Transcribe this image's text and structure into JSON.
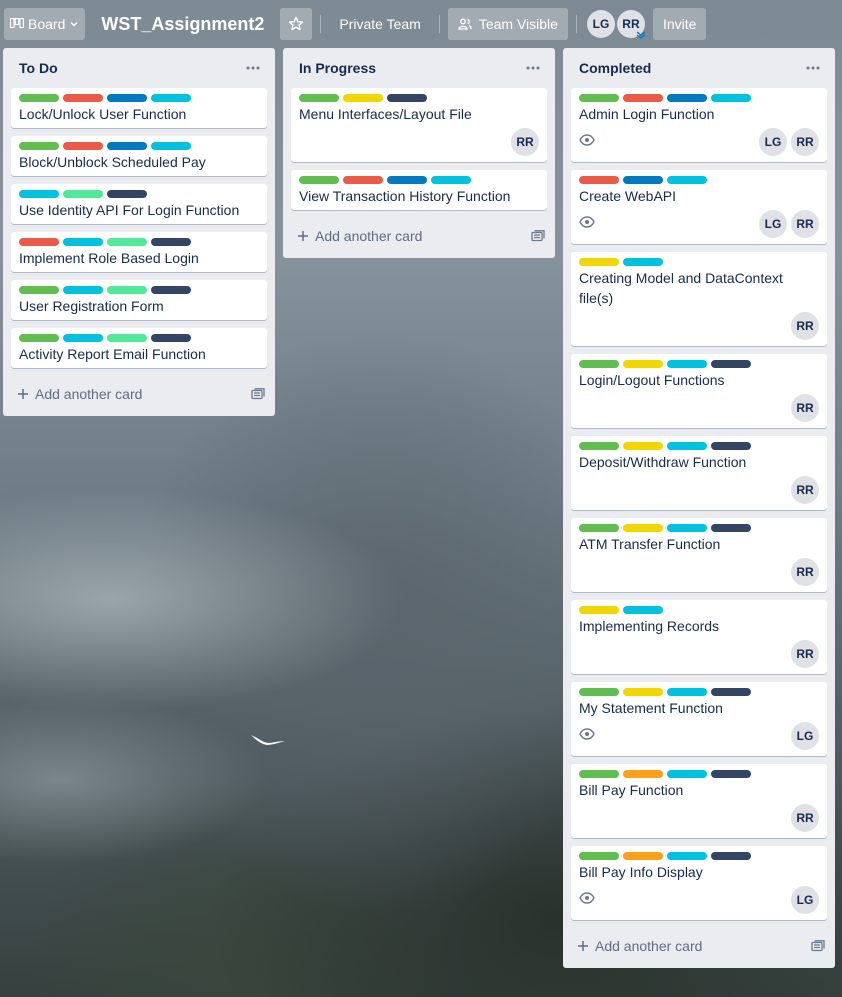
{
  "header": {
    "board_switcher_label": "Board",
    "title": "WST_Assignment2",
    "team_label": "Private Team",
    "visibility_label": "Team Visible",
    "members": [
      "LG",
      "RR"
    ],
    "invite_label": "Invite"
  },
  "colors": {
    "green": "#61bd4f",
    "red": "#eb5a46",
    "blue": "#0079bf",
    "sky": "#00c2e0",
    "yellow": "#f2d600",
    "lime": "#51e898",
    "black": "#344563",
    "orange": "#ff9f1a"
  },
  "lists": [
    {
      "title": "To Do",
      "add_label": "Add another card",
      "cards": [
        {
          "title": "Lock/Unlock User Function",
          "labels": [
            "green",
            "red",
            "blue",
            "sky"
          ],
          "watch": false,
          "members": []
        },
        {
          "title": "Block/Unblock Scheduled Pay",
          "labels": [
            "green",
            "red",
            "blue",
            "sky"
          ],
          "watch": false,
          "members": []
        },
        {
          "title": "Use Identity API For Login Function",
          "labels": [
            "sky",
            "lime",
            "black"
          ],
          "watch": false,
          "members": []
        },
        {
          "title": "Implement Role Based Login",
          "labels": [
            "red",
            "sky",
            "lime",
            "black"
          ],
          "watch": false,
          "members": []
        },
        {
          "title": "User Registration Form",
          "labels": [
            "green",
            "sky",
            "lime",
            "black"
          ],
          "watch": false,
          "members": []
        },
        {
          "title": "Activity Report Email Function",
          "labels": [
            "green",
            "sky",
            "lime",
            "black"
          ],
          "watch": false,
          "members": []
        }
      ]
    },
    {
      "title": "In Progress",
      "add_label": "Add another card",
      "cards": [
        {
          "title": "Menu Interfaces/Layout File",
          "labels": [
            "green",
            "yellow",
            "black"
          ],
          "watch": false,
          "members": [
            "RR"
          ]
        },
        {
          "title": "View Transaction History Function",
          "labels": [
            "green",
            "red",
            "blue",
            "sky"
          ],
          "watch": false,
          "members": []
        }
      ]
    },
    {
      "title": "Completed",
      "add_label": "Add another card",
      "cards": [
        {
          "title": "Admin Login Function",
          "labels": [
            "green",
            "red",
            "blue",
            "sky"
          ],
          "watch": true,
          "members": [
            "LG",
            "RR"
          ]
        },
        {
          "title": "Create WebAPI",
          "labels": [
            "red",
            "blue",
            "sky"
          ],
          "watch": true,
          "members": [
            "LG",
            "RR"
          ]
        },
        {
          "title": "Creating Model and DataContext file(s)",
          "labels": [
            "yellow",
            "sky"
          ],
          "watch": false,
          "members": [
            "RR"
          ]
        },
        {
          "title": "Login/Logout Functions",
          "labels": [
            "green",
            "yellow",
            "sky",
            "black"
          ],
          "watch": false,
          "members": [
            "RR"
          ]
        },
        {
          "title": "Deposit/Withdraw Function",
          "labels": [
            "green",
            "yellow",
            "sky",
            "black"
          ],
          "watch": false,
          "members": [
            "RR"
          ]
        },
        {
          "title": "ATM Transfer Function",
          "labels": [
            "green",
            "yellow",
            "sky",
            "black"
          ],
          "watch": false,
          "members": [
            "RR"
          ]
        },
        {
          "title": "Implementing Records",
          "labels": [
            "yellow",
            "sky"
          ],
          "watch": false,
          "members": [
            "RR"
          ]
        },
        {
          "title": "My Statement Function",
          "labels": [
            "green",
            "yellow",
            "sky",
            "black"
          ],
          "watch": true,
          "members": [
            "LG"
          ]
        },
        {
          "title": "Bill Pay Function",
          "labels": [
            "green",
            "orange",
            "sky",
            "black"
          ],
          "watch": false,
          "members": [
            "RR"
          ]
        },
        {
          "title": "Bill Pay Info Display",
          "labels": [
            "green",
            "orange",
            "sky",
            "black"
          ],
          "watch": true,
          "members": [
            "LG"
          ]
        }
      ]
    }
  ]
}
